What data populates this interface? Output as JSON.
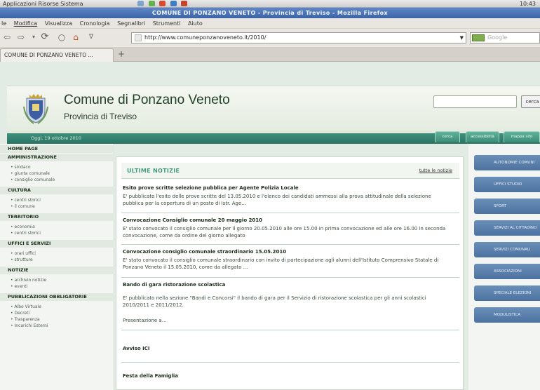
{
  "system": {
    "app_menu": "Applicazioni  Risorse  Sistema",
    "clock": "10:43",
    "icon_colors": [
      "#7fa3cf",
      "#66b04f",
      "#d94b2c",
      "#3e7cc4",
      "#c4452a"
    ]
  },
  "window": {
    "title": "COMUNE DI PONZANO VENETO - Provincia di Treviso - Mozilla Firefox"
  },
  "menubar": [
    "le",
    "Modifica",
    "Visualizza",
    "Cronologia",
    "Segnalibri",
    "Strumenti",
    "Aiuto"
  ],
  "navbar": {
    "url": "http://www.comuneponzanoveneto.it/2010/",
    "search_placeholder": "Google"
  },
  "tabs": [
    {
      "label": "COMUNE DI PONZANO VENETO ..."
    }
  ],
  "header": {
    "title_first": "Comune",
    "title_rest": " di Ponzano Veneto",
    "subtitle": "Provincia di Treviso",
    "search_button": "cerca",
    "date": "Oggi, 19 ottobre 2010",
    "top_tabs": [
      "cerca",
      "accessibilità",
      "mappa sito"
    ]
  },
  "left": {
    "sections": [
      {
        "title": "HOME PAGE",
        "links": []
      },
      {
        "title": "AMMINISTRAZIONE",
        "links": [
          "sindaco",
          "giunta comunale",
          "consiglio comunale"
        ]
      },
      {
        "title": "CULTURA",
        "links": [
          "centri storici",
          "il comune"
        ]
      },
      {
        "title": "TERRITORIO",
        "links": [
          "economia",
          "centri storici"
        ]
      },
      {
        "title": "UFFICI E SERVIZI",
        "links": [
          "orari uffici",
          "strutture"
        ]
      },
      {
        "title": "NOTIZIE",
        "links": [
          "archivio notizie",
          "eventi"
        ]
      },
      {
        "title": "PUBBLICAZIONI OBBLIGATORIE",
        "links": [
          "Albo Virtuale",
          "Decreti",
          "Trasparenza",
          "Incarichi Esterni"
        ]
      }
    ]
  },
  "news": {
    "heading": "ULTIME NOTIZIE",
    "all_link": "tutte le notizie",
    "items": [
      {
        "title": "Esito prove scritte selezione pubblica per Agente Polizia Locale",
        "text": "E' pubblicato l'esito delle prove scritte del 13.05.2010 e l'elenco dei candidati ammessi alla prova attitudinale della selezione pubblica per la copertura di un posto di Istr. Age..."
      },
      {
        "title": "Convocazione Consiglio comunale 20 maggio 2010",
        "text": "E' stato convocato il consiglio comunale per il giorno 20.05.2010 alle ore 15.00 in prima convocazione ed alle ore 16.00 in seconda convocazione, come da ordine del giorno allegato"
      },
      {
        "title": "Convocazione consiglio comunale straordinario 15.05.2010",
        "text": "E' stato convocato il consiglio comunale straordinario con invito di partecipazione agli alunni dell'Istituto Comprensivo Statale di Ponzano Veneto il 15.05.2010, come da allegato ..."
      },
      {
        "title": "Bando di gara ristorazione scolastica",
        "text": "E' pubblicato nella sezione \"Bandi e Concorsi\" il bando di gara per il Servizio di ristorazione scolastica per gli anni scolastici 2010/2011 e 2011/2012.",
        "more": "Presentazione a..."
      },
      {
        "title": "Avviso ICI",
        "text": ""
      },
      {
        "title": "Festa della Famiglia",
        "text": ""
      }
    ]
  },
  "right": {
    "buttons": [
      "AUTONOMIE COMUNI",
      "UFFICI STUDIO",
      "SPORT",
      "SERVIZI AL CITTADINO",
      "SERVIZI COMUNALI",
      "ASSOCIAZIONI",
      "SPECIALE ELEZIONI",
      "MODULISTICA"
    ]
  }
}
